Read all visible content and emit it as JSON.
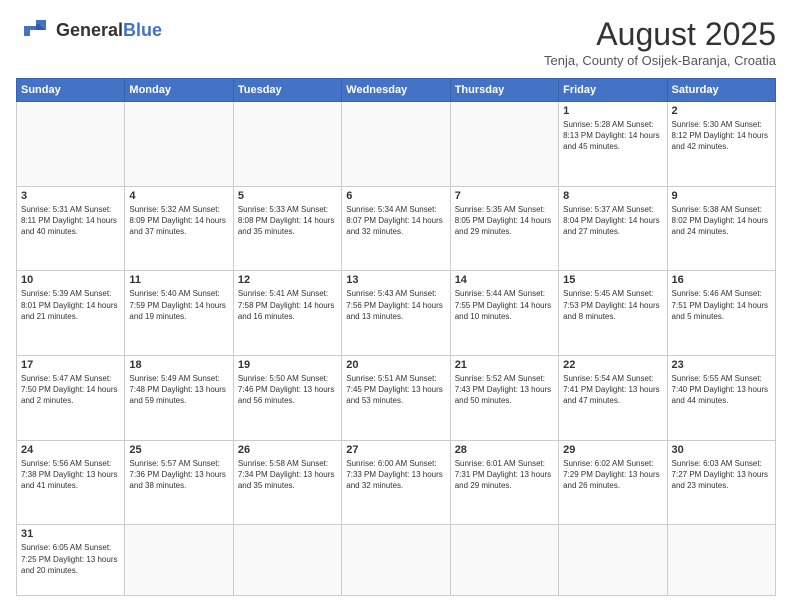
{
  "header": {
    "logo_general": "General",
    "logo_blue": "Blue",
    "month_year": "August 2025",
    "location": "Tenja, County of Osijek-Baranja, Croatia"
  },
  "weekdays": [
    "Sunday",
    "Monday",
    "Tuesday",
    "Wednesday",
    "Thursday",
    "Friday",
    "Saturday"
  ],
  "weeks": [
    [
      {
        "day": "",
        "info": ""
      },
      {
        "day": "",
        "info": ""
      },
      {
        "day": "",
        "info": ""
      },
      {
        "day": "",
        "info": ""
      },
      {
        "day": "",
        "info": ""
      },
      {
        "day": "1",
        "info": "Sunrise: 5:28 AM\nSunset: 8:13 PM\nDaylight: 14 hours\nand 45 minutes."
      },
      {
        "day": "2",
        "info": "Sunrise: 5:30 AM\nSunset: 8:12 PM\nDaylight: 14 hours\nand 42 minutes."
      }
    ],
    [
      {
        "day": "3",
        "info": "Sunrise: 5:31 AM\nSunset: 8:11 PM\nDaylight: 14 hours\nand 40 minutes."
      },
      {
        "day": "4",
        "info": "Sunrise: 5:32 AM\nSunset: 8:09 PM\nDaylight: 14 hours\nand 37 minutes."
      },
      {
        "day": "5",
        "info": "Sunrise: 5:33 AM\nSunset: 8:08 PM\nDaylight: 14 hours\nand 35 minutes."
      },
      {
        "day": "6",
        "info": "Sunrise: 5:34 AM\nSunset: 8:07 PM\nDaylight: 14 hours\nand 32 minutes."
      },
      {
        "day": "7",
        "info": "Sunrise: 5:35 AM\nSunset: 8:05 PM\nDaylight: 14 hours\nand 29 minutes."
      },
      {
        "day": "8",
        "info": "Sunrise: 5:37 AM\nSunset: 8:04 PM\nDaylight: 14 hours\nand 27 minutes."
      },
      {
        "day": "9",
        "info": "Sunrise: 5:38 AM\nSunset: 8:02 PM\nDaylight: 14 hours\nand 24 minutes."
      }
    ],
    [
      {
        "day": "10",
        "info": "Sunrise: 5:39 AM\nSunset: 8:01 PM\nDaylight: 14 hours\nand 21 minutes."
      },
      {
        "day": "11",
        "info": "Sunrise: 5:40 AM\nSunset: 7:59 PM\nDaylight: 14 hours\nand 19 minutes."
      },
      {
        "day": "12",
        "info": "Sunrise: 5:41 AM\nSunset: 7:58 PM\nDaylight: 14 hours\nand 16 minutes."
      },
      {
        "day": "13",
        "info": "Sunrise: 5:43 AM\nSunset: 7:56 PM\nDaylight: 14 hours\nand 13 minutes."
      },
      {
        "day": "14",
        "info": "Sunrise: 5:44 AM\nSunset: 7:55 PM\nDaylight: 14 hours\nand 10 minutes."
      },
      {
        "day": "15",
        "info": "Sunrise: 5:45 AM\nSunset: 7:53 PM\nDaylight: 14 hours\nand 8 minutes."
      },
      {
        "day": "16",
        "info": "Sunrise: 5:46 AM\nSunset: 7:51 PM\nDaylight: 14 hours\nand 5 minutes."
      }
    ],
    [
      {
        "day": "17",
        "info": "Sunrise: 5:47 AM\nSunset: 7:50 PM\nDaylight: 14 hours\nand 2 minutes."
      },
      {
        "day": "18",
        "info": "Sunrise: 5:49 AM\nSunset: 7:48 PM\nDaylight: 13 hours\nand 59 minutes."
      },
      {
        "day": "19",
        "info": "Sunrise: 5:50 AM\nSunset: 7:46 PM\nDaylight: 13 hours\nand 56 minutes."
      },
      {
        "day": "20",
        "info": "Sunrise: 5:51 AM\nSunset: 7:45 PM\nDaylight: 13 hours\nand 53 minutes."
      },
      {
        "day": "21",
        "info": "Sunrise: 5:52 AM\nSunset: 7:43 PM\nDaylight: 13 hours\nand 50 minutes."
      },
      {
        "day": "22",
        "info": "Sunrise: 5:54 AM\nSunset: 7:41 PM\nDaylight: 13 hours\nand 47 minutes."
      },
      {
        "day": "23",
        "info": "Sunrise: 5:55 AM\nSunset: 7:40 PM\nDaylight: 13 hours\nand 44 minutes."
      }
    ],
    [
      {
        "day": "24",
        "info": "Sunrise: 5:56 AM\nSunset: 7:38 PM\nDaylight: 13 hours\nand 41 minutes."
      },
      {
        "day": "25",
        "info": "Sunrise: 5:57 AM\nSunset: 7:36 PM\nDaylight: 13 hours\nand 38 minutes."
      },
      {
        "day": "26",
        "info": "Sunrise: 5:58 AM\nSunset: 7:34 PM\nDaylight: 13 hours\nand 35 minutes."
      },
      {
        "day": "27",
        "info": "Sunrise: 6:00 AM\nSunset: 7:33 PM\nDaylight: 13 hours\nand 32 minutes."
      },
      {
        "day": "28",
        "info": "Sunrise: 6:01 AM\nSunset: 7:31 PM\nDaylight: 13 hours\nand 29 minutes."
      },
      {
        "day": "29",
        "info": "Sunrise: 6:02 AM\nSunset: 7:29 PM\nDaylight: 13 hours\nand 26 minutes."
      },
      {
        "day": "30",
        "info": "Sunrise: 6:03 AM\nSunset: 7:27 PM\nDaylight: 13 hours\nand 23 minutes."
      }
    ],
    [
      {
        "day": "31",
        "info": "Sunrise: 6:05 AM\nSunset: 7:25 PM\nDaylight: 13 hours\nand 20 minutes."
      },
      {
        "day": "",
        "info": ""
      },
      {
        "day": "",
        "info": ""
      },
      {
        "day": "",
        "info": ""
      },
      {
        "day": "",
        "info": ""
      },
      {
        "day": "",
        "info": ""
      },
      {
        "day": "",
        "info": ""
      }
    ]
  ]
}
